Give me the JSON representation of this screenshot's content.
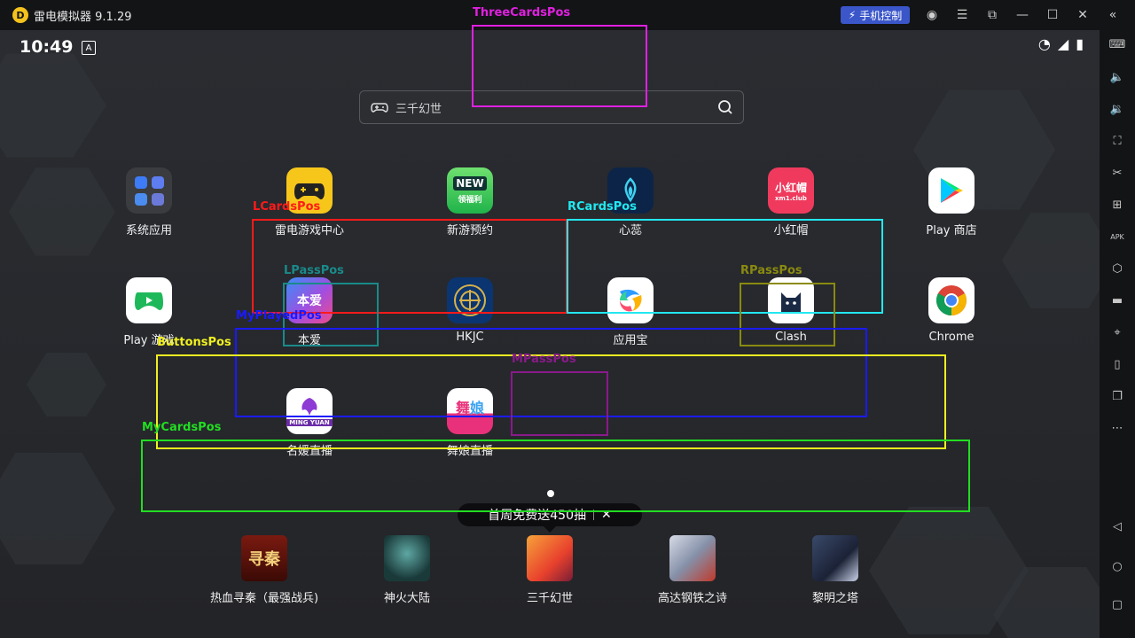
{
  "window": {
    "title": "雷电模拟器 9.1.29",
    "logo_icon": "thunder-logo-icon",
    "phone_control_label": "手机控制"
  },
  "status": {
    "time": "10:49",
    "a_badge": "A"
  },
  "search": {
    "text": "三千幻世"
  },
  "apps_row1": [
    {
      "label": "系统应用",
      "icon": "system-apps-folder-icon"
    },
    {
      "label": "雷电游戏中心",
      "icon": "gamepad-icon"
    },
    {
      "label": "新游预约",
      "icon": "new-games-icon",
      "icon_text": "NEW",
      "icon_subtext": "领福利"
    },
    {
      "label": "心蕊",
      "icon": "xinrui-icon"
    },
    {
      "label": "小红帽",
      "icon": "xiaohongmao-icon",
      "icon_text": "小红帽",
      "icon_subtext": "xm1.club"
    },
    {
      "label": "Play 商店",
      "icon": "play-store-icon"
    }
  ],
  "apps_row2": [
    {
      "label": "Play 游戏",
      "icon": "play-games-icon"
    },
    {
      "label": "本爱",
      "icon": "benai-icon"
    },
    {
      "label": "HKJC",
      "icon": "hkjc-icon"
    },
    {
      "label": "应用宝",
      "icon": "yingyongbao-icon"
    },
    {
      "label": "Clash",
      "icon": "clash-cat-icon"
    },
    {
      "label": "Chrome",
      "icon": "chrome-icon"
    }
  ],
  "apps_row3": [
    {
      "label": "名媛直播",
      "icon": "mingyuan-icon",
      "icon_text": "MING YUAN"
    },
    {
      "label": "舞娘直播",
      "icon": "wuniang-icon"
    }
  ],
  "promo": {
    "text": "首周免费送450抽",
    "close": "✕"
  },
  "dock": [
    {
      "label": "热血寻秦（最强战兵)",
      "icon": "xunqin-game-icon",
      "icon_text": "寻秦"
    },
    {
      "label": "神火大陆",
      "icon": "shenhuo-game-icon"
    },
    {
      "label": "三千幻世",
      "icon": "sanqian-game-icon"
    },
    {
      "label": "高达钢铁之诗",
      "icon": "gundam-game-icon"
    },
    {
      "label": "黎明之塔",
      "icon": "liming-game-icon"
    }
  ],
  "overlays": [
    {
      "name": "ThreeCardsPos",
      "color": "#e020e0"
    },
    {
      "name": "LCardsPos",
      "color": "#ff1a1a"
    },
    {
      "name": "RCardsPos",
      "color": "#22e8f0"
    },
    {
      "name": "LPassPos",
      "color": "#1a8a8a"
    },
    {
      "name": "RPassPos",
      "color": "#8a8a10"
    },
    {
      "name": "MyPlayedPos",
      "color": "#1a1aff"
    },
    {
      "name": "ButtonsPos",
      "color": "#f0f020"
    },
    {
      "name": "MPassPos",
      "color": "#8a1a8a"
    },
    {
      "name": "MyCardsPos",
      "color": "#22dd22"
    }
  ],
  "sidebar_icons": [
    "keyboard-icon",
    "volume-up-icon",
    "volume-down-icon",
    "screenshot-icon",
    "scissors-icon",
    "add-icon",
    "apk-icon",
    "settings-hex-icon",
    "folder-icon",
    "location-icon",
    "shake-icon",
    "multi-window-icon",
    "more-icon",
    "back-icon",
    "home-icon",
    "recents-icon"
  ]
}
